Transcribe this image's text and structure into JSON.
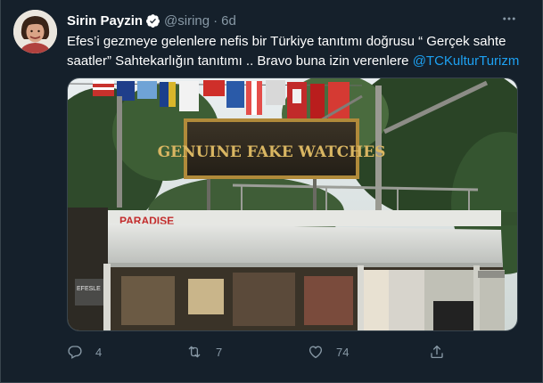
{
  "tweet": {
    "author": {
      "display_name": "Sirin Payzin",
      "handle": "@siring",
      "verified": true
    },
    "separator": "·",
    "time": "6d",
    "text_before_mention": "Efes’i gezmeye gelenlere nefis bir Türkiye tanıtımı doğrusu “ Gerçek sahte saatler” Sahtekarlığın tanıtımı .. Bravo buna izin verenlere ",
    "mention": "@TCKulturTurizm",
    "media": {
      "sign_text": "GENUINE FAKE WATCHES",
      "shop_sign_text": "PARADISE",
      "side_sign_text": "EFESLE"
    },
    "actions": {
      "reply_count": "4",
      "retweet_count": "7",
      "like_count": "74"
    }
  },
  "colors": {
    "background": "#15202b",
    "border": "#38444d",
    "secondary_text": "#8899a6",
    "link": "#1da1f2",
    "verified_badge": "#ffffff"
  },
  "icons": {
    "more": "more-horizontal-icon",
    "verified": "verified-badge-icon",
    "reply": "reply-icon",
    "retweet": "retweet-icon",
    "like": "heart-icon",
    "share": "share-icon"
  }
}
